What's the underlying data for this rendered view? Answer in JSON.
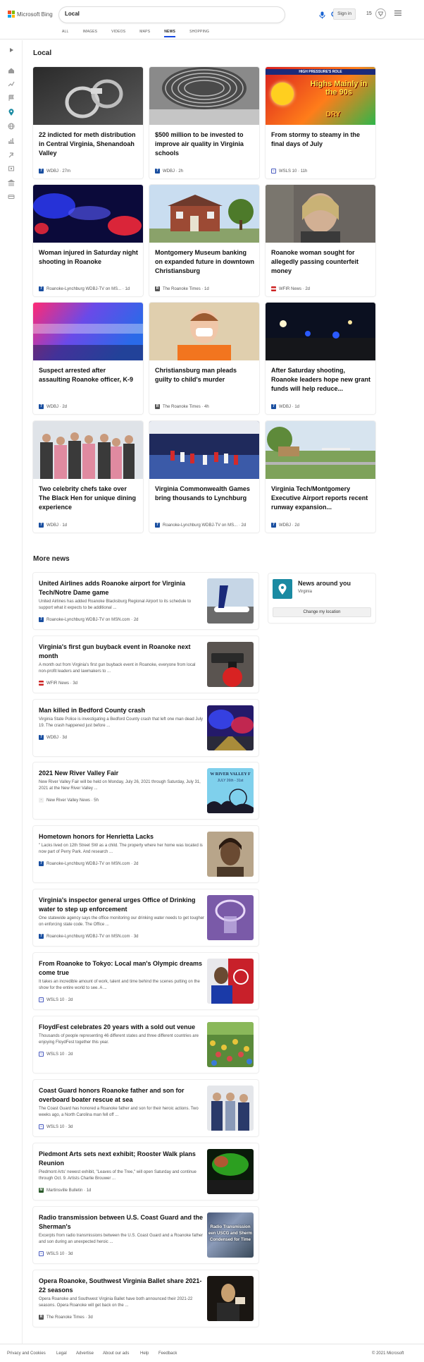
{
  "header": {
    "logo_text": "Microsoft Bing",
    "search_value": "Local",
    "sign_in": "Sign in",
    "points": "15",
    "brand_colors": [
      "#f25022",
      "#7fba00",
      "#00a4ef",
      "#ffb900"
    ],
    "accent": "#174ae4",
    "icons": [
      "mic-icon",
      "search-icon",
      "rewards-icon",
      "menu-icon"
    ]
  },
  "tabs": [
    {
      "label": "ALL"
    },
    {
      "label": "IMAGES"
    },
    {
      "label": "VIDEOS"
    },
    {
      "label": "MAPS"
    },
    {
      "label": "NEWS",
      "active": true
    },
    {
      "label": "SHOPPING"
    }
  ],
  "rail_icons": [
    "play-icon",
    "home-icon",
    "trending-icon",
    "flag-icon",
    "location-icon",
    "globe-icon",
    "business-icon",
    "science-icon",
    "sports-icon",
    "entertainment-icon",
    "politics-icon",
    "money-icon"
  ],
  "local": {
    "title": "Local",
    "cards": [
      {
        "title": "22 indicted for meth distribution in Central Virginia, Shenandoah Valley",
        "source": "WDBJ",
        "age": "27m"
      },
      {
        "title": "$500 million to be invested to improve air quality in Virginia schools",
        "source": "WDBJ",
        "age": "2h"
      },
      {
        "title": "From stormy to steamy in the final days of July",
        "source": "WSLS 10",
        "age": "11h",
        "thumb_caption_top": "HIGH PRESSURE'S ROLE",
        "thumb_caption": "Highs Mainly in the 90s",
        "thumb_caption2": "DRY"
      },
      {
        "title": "Woman injured in Saturday night shooting in Roanoke",
        "source": "Roanoke-Lynchburg WDBJ-TV on MS...",
        "age": "1d"
      },
      {
        "title": "Montgomery Museum banking on expanded future in downtown Christiansburg",
        "source": "The Roanoke Times",
        "age": "1d"
      },
      {
        "title": "Roanoke woman sought for allegedly passing counterfeit money",
        "source": "WFIR News",
        "age": "2d"
      },
      {
        "title": "Suspect arrested after assaulting Roanoke officer, K-9",
        "source": "WDBJ",
        "age": "2d"
      },
      {
        "title": "Christiansburg man pleads guilty to child's murder",
        "source": "The Roanoke Times",
        "age": "4h"
      },
      {
        "title": "After Saturday shooting, Roanoke leaders hope new grant funds will help reduce...",
        "source": "WDBJ",
        "age": "1d"
      },
      {
        "title": "Two celebrity chefs take over The Black Hen for unique dining experience",
        "source": "WDBJ",
        "age": "1d"
      },
      {
        "title": "Virginia Commonwealth Games bring thousands to Lynchburg",
        "source": "Roanoke-Lynchburg WDBJ-TV on MS...",
        "age": "2d"
      },
      {
        "title": "Virginia Tech/Montgomery Executive Airport reports recent runway expansion...",
        "source": "WDBJ",
        "age": "2d"
      }
    ]
  },
  "more_news": {
    "title": "More news",
    "items": [
      {
        "title": "United Airlines adds Roanoke airport for Virginia Tech/Notre Dame game",
        "snippet": "United Airlines has added Roanoke Blacksburg Regional Airport to its schedule to support what it expects to be additional ...",
        "source": "Roanoke-Lynchburg WDBJ-TV on MSN.com",
        "age": "2d"
      },
      {
        "title": "Virginia's first gun buyback event in Roanoke next month",
        "snippet": "A month out from Virginia's first gun buyback event in Roanoke, everyone from local non-profit leaders and lawmakers to ...",
        "source": "WFIR News",
        "age": "3d"
      },
      {
        "title": "Man killed in Bedford County crash",
        "snippet": "Virginia State Police is investigating a Bedford County crash that left one man dead July 19. The crash happened just before ...",
        "source": "WDBJ",
        "age": "3d"
      },
      {
        "title": "2021 New River Valley Fair",
        "snippet": "New River Valley Fair will be held on Monday, July 26, 2021 through Saturday, July 31, 2021 at the New River Valley ...",
        "source": "New River Valley News",
        "age": "5h",
        "thumb_caption": "W RIVER VALLEY F",
        "thumb_caption2": "JULY 26th - 31st"
      },
      {
        "title": "Hometown honors for Henrietta Lacks",
        "snippet": "\" Lacks lived on 12th Street SW as a child. The property where her home was located is now part of Perry Park. And research ...",
        "source": "Roanoke-Lynchburg WDBJ-TV on MSN.com",
        "age": "2d"
      },
      {
        "title": "Virginia's inspector general urges Office of Drinking water to step up enforcement",
        "snippet": "One statewide agency says the office monitoring our drinking water needs to get tougher on enforcing state code. The Office ...",
        "source": "Roanoke-Lynchburg WDBJ-TV on MSN.com",
        "age": "3d"
      },
      {
        "title": "From Roanoke to Tokyo: Local man's Olympic dreams come true",
        "snippet": "It takes an incredible amount of work, talent and time behind the scenes putting on the show for the entire world to see. A ...",
        "source": "WSLS 10",
        "age": "2d"
      },
      {
        "title": "FloydFest celebrates 20 years with a sold out venue",
        "snippet": "Thousands of people representing 46 different states and three different countries are enjoying FloydFest together this year.",
        "source": "WSLS 10",
        "age": "2d"
      },
      {
        "title": "Coast Guard honors Roanoke father and son for overboard boater rescue at sea",
        "snippet": "The Coast Guard has honored a Roanoke father and son for their heroic actions. Two weeks ago, a North Carolina man fell off ...",
        "source": "WSLS 10",
        "age": "3d"
      },
      {
        "title": "Piedmont Arts sets next exhibit; Rooster Walk plans Reunion",
        "snippet": "Piedmont Arts' newest exhibit, \"Leaves of the Tree,\" will open Saturday and continue through Oct. 9. Artists Charlie Brouwer ...",
        "source": "Martinsville Bulletin",
        "age": "1d"
      },
      {
        "title": "Radio transmission between U.S. Coast Guard and the Sherman's",
        "snippet": "Excerpts from radio transmissions between the U.S. Coast Guard and a Roanoke father and son during an unexpected heroic ...",
        "source": "WSLS 10",
        "age": "3d",
        "thumb_caption": "Radio Transmission",
        "thumb_caption2": "een USCG and Sherm",
        "thumb_caption3": "Condensed for Time"
      },
      {
        "title": "Opera Roanoke, Southwest Virginia Ballet share 2021-22 seasons",
        "snippet": "Opera Roanoke and Southwest Virginia Ballet have both announced their 2021-22 seasons. Opera Roanoke will get back on the ...",
        "source": "The Roanoke Times",
        "age": "3d"
      }
    ]
  },
  "around_you": {
    "title": "News around you",
    "location": "Virginia",
    "button": "Change my location"
  },
  "footer": {
    "links": [
      "Privacy and Cookies",
      "Legal",
      "Advertise",
      "About our ads",
      "Help",
      "Feedback"
    ],
    "copyright": "© 2021 Microsoft"
  }
}
